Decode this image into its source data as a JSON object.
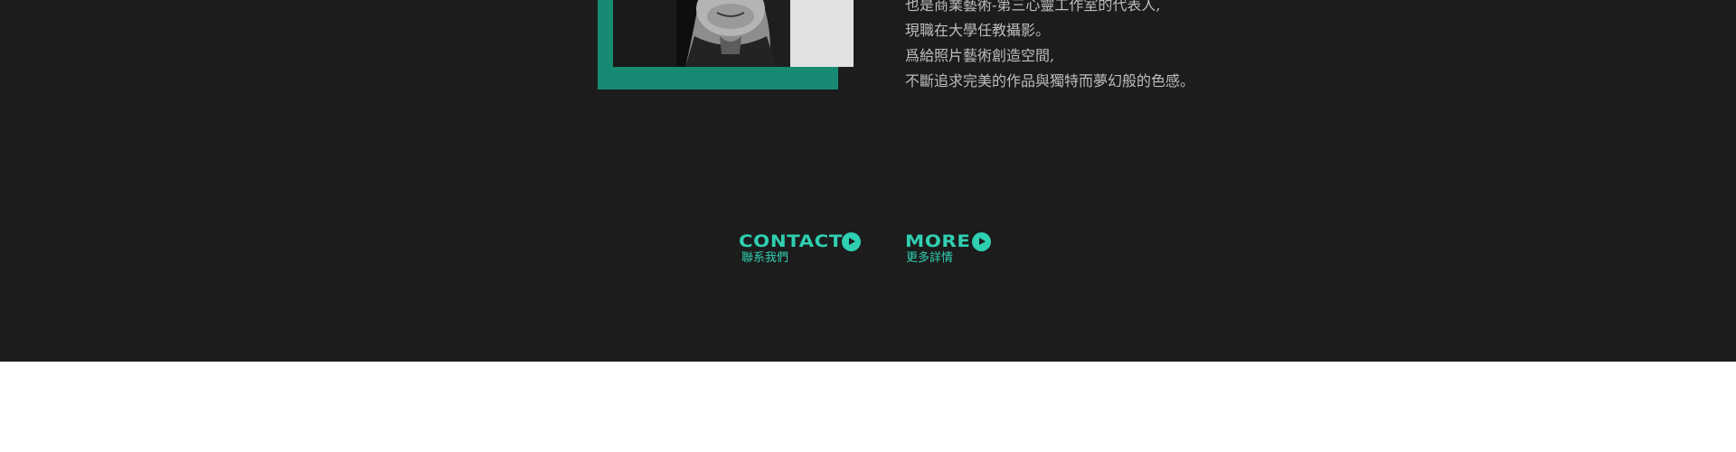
{
  "bio": {
    "lines": [
      "也是商業藝術-第三心靈工作室的代表人,",
      "現職在大學任教攝影。",
      "爲給照片藝術創造空間,",
      "不斷追求完美的作品與獨特而夢幻般的色感。"
    ]
  },
  "actions": {
    "contact": {
      "title": "CONTACT",
      "subtitle": "聯系我們",
      "icon": "play-circle-icon"
    },
    "more": {
      "title": "MORE",
      "subtitle": "更多詳情",
      "icon": "play-circle-icon"
    }
  },
  "colors": {
    "background": "#1c1c1c",
    "accent": "#2fcfb1",
    "photo_frame": "#168a72",
    "body_text": "#bdbdbd",
    "page_below": "#ffffff"
  }
}
